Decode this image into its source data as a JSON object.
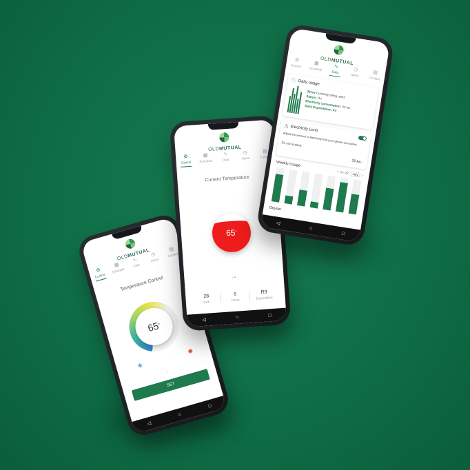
{
  "brand": {
    "prefix": "OLD",
    "name": "MUTUAL"
  },
  "tabs": [
    "Control",
    "Schedule",
    "Data",
    "Alerts",
    "Contact"
  ],
  "nav": {
    "back": "◁",
    "home": "○",
    "recent": "□"
  },
  "phone_left": {
    "title": "Temperature Control",
    "value": "65",
    "unit": "°",
    "cold_icon": "snowflake-icon",
    "hot_icon": "sun-icon",
    "set_label": "SET"
  },
  "phone_middle": {
    "title": "Current Temperature",
    "value": "65",
    "unit": "°",
    "stats": [
      {
        "value": "28",
        "label": "Kwh"
      },
      {
        "value": "6",
        "label": "Hours"
      },
      {
        "value": "R9",
        "label": "Expenditure"
      }
    ]
  },
  "phone_right": {
    "daily": {
      "title": "Daily usage",
      "line1_bold": "28 kw",
      "line1": "Currently being used",
      "status_label": "Status:",
      "status_value": "On",
      "consumption_label": "Electricity consumption:",
      "consumption_value": "32 kw",
      "expenditure_label": "Daily Expenditure:",
      "expenditure_value": "R9"
    },
    "limit": {
      "title": "Electricity Limit",
      "desc": "Adjust the amount of electricity that your geyser consumes",
      "do_not_exceed": "Do not exceed:",
      "limit_value": "25 kw"
    },
    "weekly": {
      "title": "Weekly Usage",
      "range": "6 - 12",
      "month": "July",
      "chart_data": {
        "type": "bar",
        "categories": [
          "Mon",
          "Tue",
          "Wed",
          "Thu",
          "Fri",
          "Sat",
          "Sun"
        ],
        "values": [
          28,
          8,
          16,
          6,
          22,
          30,
          20
        ],
        "ylim": [
          0,
          32
        ]
      }
    },
    "geyser_label": "Geyser"
  },
  "colors": {
    "green": "#1f7a4e",
    "red": "#ef1c1c",
    "bg": "#0f6e47"
  }
}
